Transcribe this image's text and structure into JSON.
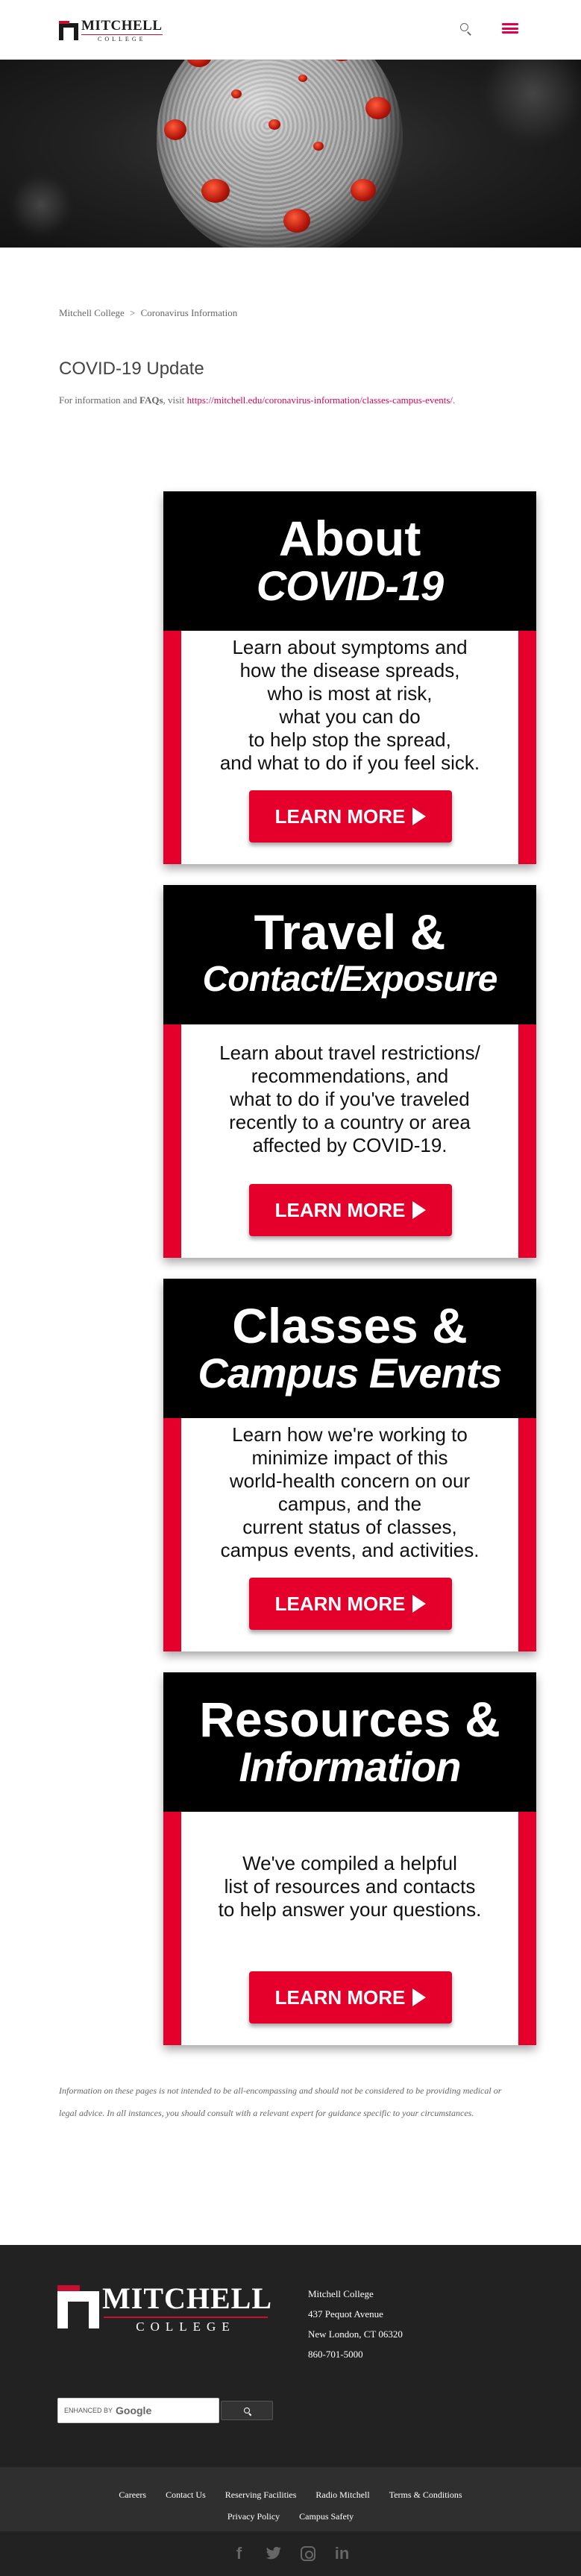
{
  "header": {
    "logo_title": "MITCHELL",
    "logo_sub": "COLLEGE",
    "search_icon": "search-icon",
    "menu_icon": "hamburger-menu-icon",
    "accent_color": "#e0004d"
  },
  "hero": {
    "image": "coronavirus-illustration"
  },
  "breadcrumb": {
    "home": "Mitchell College",
    "separator": ">",
    "current": "Coronavirus Information"
  },
  "page_title": "COVID-19 Update",
  "intro": {
    "text": "For information and ",
    "bold": "FAQs",
    "text2": ", visit ",
    "link": "https://mitchell.edu/coronavirus-information/classes-campus-events/",
    "end": "."
  },
  "cards": [
    {
      "title_line1": "About",
      "title_line2": "COVID-19",
      "body": "Learn about symptoms and\nhow the disease spreads,\nwho is most at risk,\nwhat you can do\nto help stop the spread,\nand what to do if you feel sick.",
      "button": "LEARN MORE"
    },
    {
      "title_line1": "Travel &",
      "title_line2": "Contact/Exposure",
      "body": "Learn about travel restrictions/\nrecommendations, and\nwhat to do if you've traveled\nrecently to a country or area\naffected by COVID-19.",
      "button": "LEARN MORE"
    },
    {
      "title_line1": "Classes &",
      "title_line2": "Campus Events",
      "body": "Learn how we're working to\nminimize impact of this\nworld-health concern on our\ncampus, and the\ncurrent status of classes,\ncampus events, and activities.",
      "button": "LEARN MORE"
    },
    {
      "title_line1": "Resources &",
      "title_line2": "Information",
      "body": "We've compiled a helpful\nlist of resources and contacts\nto help answer your questions.",
      "button": "LEARN MORE"
    }
  ],
  "disclaimer": "Information on these pages is not intended to be all-encompassing and should not be considered to be providing medical or legal advice. In all instances, you should consult with a relevant expert for guidance specific to your circumstances.",
  "footer": {
    "logo_title": "MITCHELL",
    "logo_sub": "COLLEGE",
    "address": [
      "Mitchell College",
      "437 Pequot Avenue",
      "New London, CT 06320",
      "860-701-5000"
    ],
    "search": {
      "label": "ENHANCED BY",
      "brand": "Google",
      "button_icon": "search-icon"
    },
    "links_row1": [
      "Careers",
      "Contact Us",
      "Reserving Facilities",
      "Radio Mitchell",
      "Terms & Conditions"
    ],
    "links_row2": [
      "Privacy Policy",
      "Campus Safety"
    ],
    "social": [
      "facebook-icon",
      "twitter-icon",
      "instagram-icon",
      "linkedin-icon"
    ]
  },
  "colors": {
    "brand_red": "#e4002b",
    "footer_bg": "#222222",
    "link": "#e0004d"
  }
}
